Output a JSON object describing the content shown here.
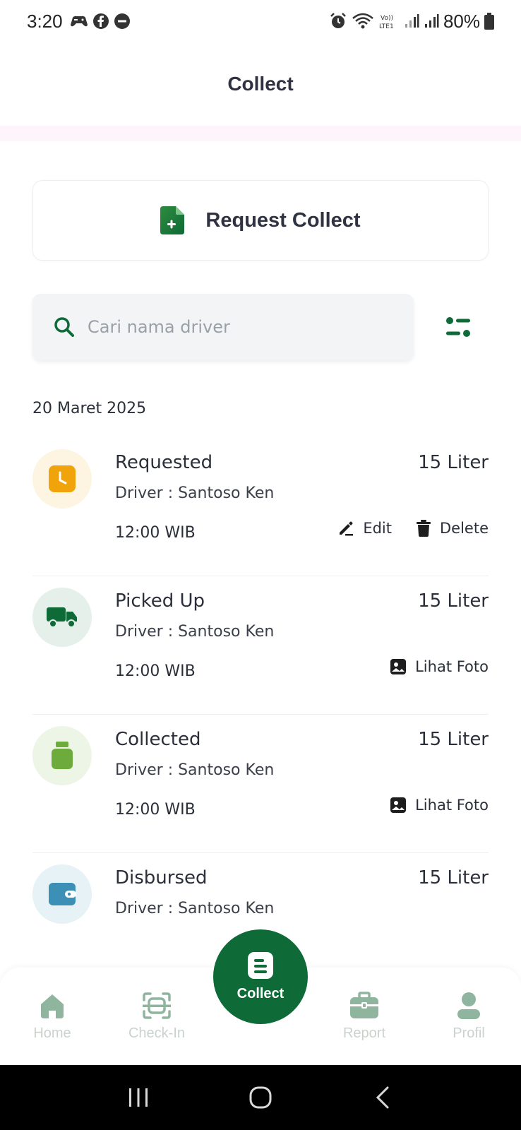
{
  "status_bar": {
    "time": "3:20",
    "battery": "80%",
    "icons_left": [
      "game-controller-icon",
      "facebook-icon",
      "do-not-disturb-icon"
    ],
    "icons_right": [
      "alarm-icon",
      "wifi-icon",
      "volte-icon",
      "signal-icon",
      "signal-icon",
      "battery-icon"
    ]
  },
  "app_bar": {
    "title": "Collect"
  },
  "request_card": {
    "label": "Request Collect",
    "icon": "file-plus-icon"
  },
  "search": {
    "placeholder": "Cari nama driver",
    "value": ""
  },
  "date_group": "20 Maret 2025",
  "items": [
    {
      "status": "Requested",
      "volume": "15 Liter",
      "driver": "Driver : Santoso Ken",
      "time": "12:00 WIB",
      "icon": "clock-icon",
      "color": "#f0a30a",
      "bg": "#fdf4e1",
      "actions": {
        "edit": "Edit",
        "delete": "Delete"
      }
    },
    {
      "status": "Picked Up",
      "volume": "15 Liter",
      "driver": "Driver : Santoso Ken",
      "time": "12:00 WIB",
      "icon": "truck-icon",
      "color": "#0e6a36",
      "bg": "#e6f0ea",
      "actions": {
        "photo": "Lihat Foto"
      }
    },
    {
      "status": "Collected",
      "volume": "15 Liter",
      "driver": "Driver : Santoso Ken",
      "time": "12:00 WIB",
      "icon": "jerrycan-icon",
      "color": "#6cab3c",
      "bg": "#edf5e6",
      "actions": {
        "photo": "Lihat Foto"
      }
    },
    {
      "status": "Disbursed",
      "volume": "15 Liter",
      "driver": "Driver : Santoso Ken",
      "time": "",
      "icon": "wallet-icon",
      "color": "#3c8fb5",
      "bg": "#e7f2f6",
      "actions": {}
    }
  ],
  "bottom_nav": {
    "home": "Home",
    "checkin": "Check-In",
    "collect": "Collect",
    "report": "Report",
    "profile": "Profil"
  },
  "colors": {
    "primary": "#0e6a36",
    "nav_inactive": "#c9d3cd",
    "nav_icon_inactive": "#8fb59f"
  }
}
